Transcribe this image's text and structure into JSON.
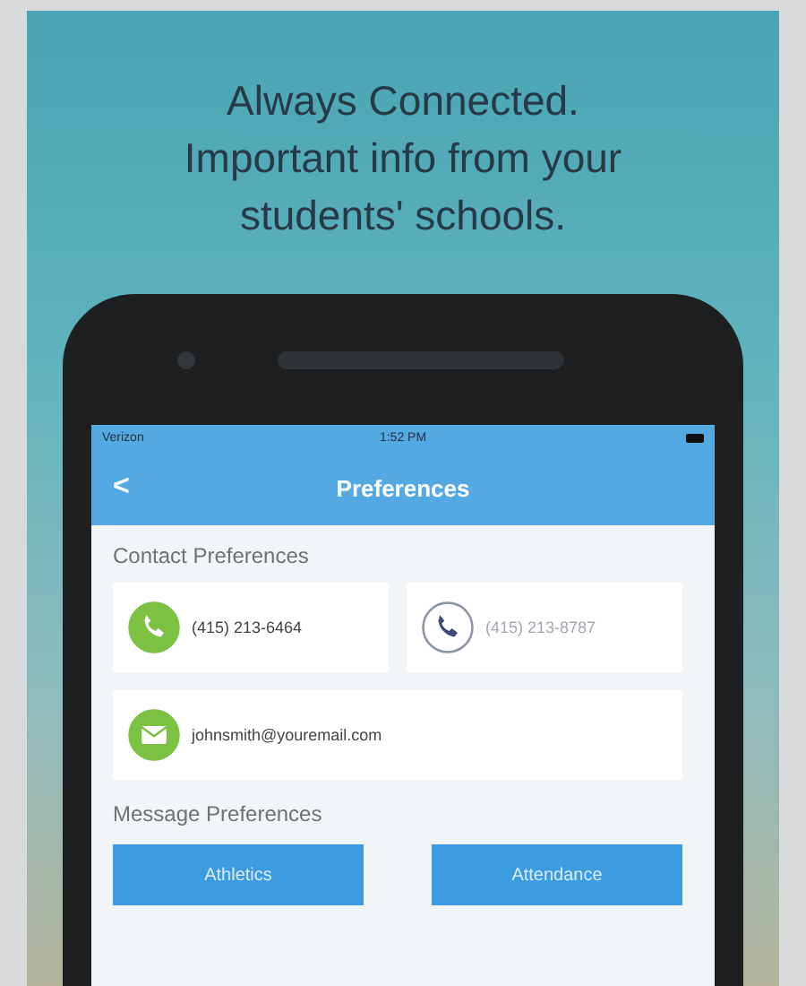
{
  "headline": [
    "Always Connected.",
    "Important info from your",
    "students' schools."
  ],
  "status_bar": {
    "carrier": "Verizon",
    "time": "1:52 PM"
  },
  "nav_bar": {
    "back": "<",
    "title": "Preferences"
  },
  "contact_preferences": {
    "heading": "Contact Preferences",
    "items": [
      {
        "kind": "phone",
        "value": "(415) 213-6464",
        "active": true
      },
      {
        "kind": "phone",
        "value": "(415) 213-8787",
        "active": false
      },
      {
        "kind": "email",
        "value": "johnsmith@youremail.com",
        "active": true
      }
    ]
  },
  "message_preferences": {
    "heading": "Message Preferences",
    "buttons": [
      {
        "label": "Athletics"
      },
      {
        "label": "Attendance"
      }
    ]
  }
}
